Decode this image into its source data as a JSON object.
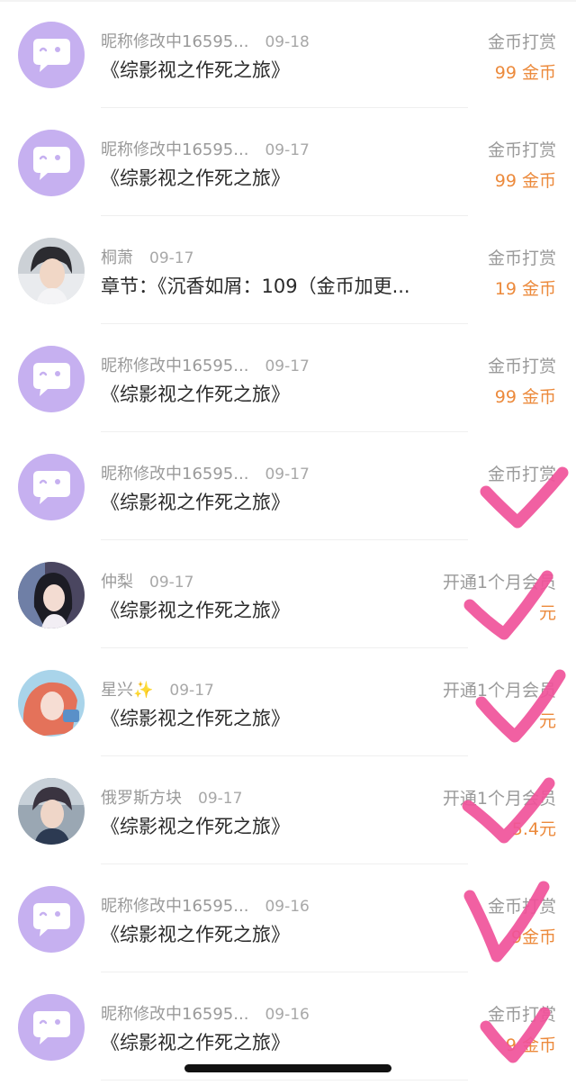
{
  "rows": [
    {
      "name": "昵称修改中16595...",
      "date": "09-18",
      "title": "《综影视之作死之旅》",
      "type": "金币打赏",
      "amount": "99 金币",
      "avatar": "purple-chat-avatar"
    },
    {
      "name": "昵称修改中16595...",
      "date": "09-17",
      "title": "《综影视之作死之旅》",
      "type": "金币打赏",
      "amount": "99 金币",
      "avatar": "purple-chat-avatar"
    },
    {
      "name": "桐萧",
      "date": "09-17",
      "title": "章节：《沉香如屑：109（金币加更...",
      "type": "金币打赏",
      "amount": "19 金币",
      "avatar": "photo-avatar-man"
    },
    {
      "name": "昵称修改中16595...",
      "date": "09-17",
      "title": "《综影视之作死之旅》",
      "type": "金币打赏",
      "amount": "99 金币",
      "avatar": "purple-chat-avatar"
    },
    {
      "name": "昵称修改中16595...",
      "date": "09-17",
      "title": "《综影视之作死之旅》",
      "type": "金币打赏",
      "amount": "",
      "avatar": "purple-chat-avatar"
    },
    {
      "name": "仲梨",
      "date": "09-17",
      "title": "《综影视之作死之旅》",
      "type": "开通1个月会员",
      "amount": "元",
      "avatar": "photo-avatar-girl"
    },
    {
      "name": "星兴✨",
      "date": "09-17",
      "title": "《综影视之作死之旅》",
      "type": "开通1个月会员",
      "amount": "元",
      "avatar": "photo-avatar-redhair"
    },
    {
      "name": "俄罗斯方块",
      "date": "09-17",
      "title": "《综影视之作死之旅》",
      "type": "开通1个月会员",
      "amount": "5.4元",
      "avatar": "photo-avatar-boy"
    },
    {
      "name": "昵称修改中16595...",
      "date": "09-16",
      "title": "《综影视之作死之旅》",
      "type": "金币打赏",
      "amount": "9金币",
      "avatar": "purple-chat-avatar"
    },
    {
      "name": "昵称修改中16595...",
      "date": "09-16",
      "title": "《综影视之作死之旅》",
      "type": "金币打赏",
      "amount": "9 金币",
      "avatar": "purple-chat-avatar"
    }
  ],
  "colors": {
    "accent_amount": "#ec8a3c",
    "avatar_purple": "#c6b0f0",
    "check_mark": "#f0529a"
  },
  "overlay": {
    "check_marks_on_rows": [
      5,
      6,
      7,
      8,
      9,
      10
    ]
  }
}
